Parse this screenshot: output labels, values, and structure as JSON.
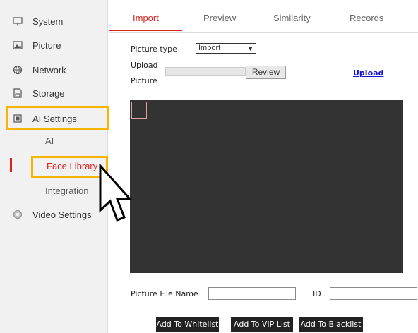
{
  "sidebar": {
    "items": [
      {
        "label": "System",
        "icon": "monitor-icon"
      },
      {
        "label": "Picture",
        "icon": "picture-icon"
      },
      {
        "label": "Network",
        "icon": "globe-icon"
      },
      {
        "label": "Storage",
        "icon": "storage-icon"
      },
      {
        "label": "AI Settings",
        "icon": "ai-settings-icon"
      },
      {
        "label": "Video Settings",
        "icon": "video-settings-icon"
      }
    ],
    "sub_items": [
      {
        "label": "AI"
      },
      {
        "label": "Face Library"
      },
      {
        "label": "Integration"
      }
    ],
    "active_color": "#e02020",
    "highlight_color": "#f7b500"
  },
  "tabs": [
    {
      "label": "Import"
    },
    {
      "label": "Preview"
    },
    {
      "label": "Similarity"
    },
    {
      "label": "Records"
    }
  ],
  "form": {
    "picture_type_label": "Picture type",
    "picture_type_value": "Import",
    "upload_picture_label_line1": "Upload",
    "upload_picture_label_line2": "Picture",
    "review_button": "Review",
    "upload_link": "Upload",
    "file_name_label": "Picture File Name",
    "file_name_value": "",
    "id_label": "ID",
    "id_value": ""
  },
  "buttons": {
    "whitelist": "Add To Whitelist",
    "vip": "Add To VIP List",
    "blacklist": "Add To Blacklist"
  }
}
